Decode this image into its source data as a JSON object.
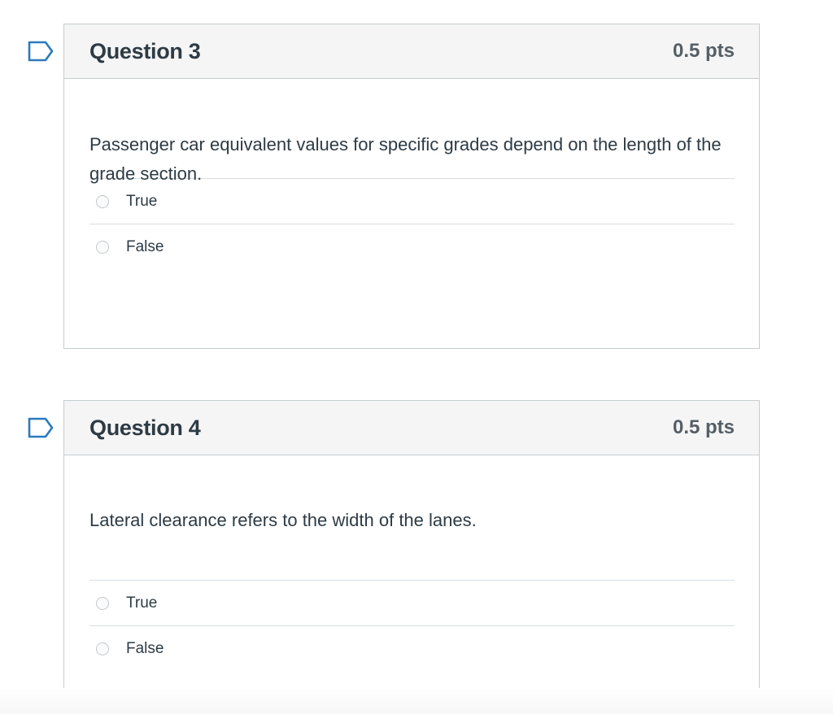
{
  "questions": [
    {
      "title": "Question 3",
      "points": "0.5 pts",
      "text": "Passenger car equivalent values for specific grades depend on the length of the grade section.",
      "answers": [
        "True",
        "False"
      ]
    },
    {
      "title": "Question 4",
      "points": "0.5 pts",
      "text": "Lateral clearance refers to the width of the lanes.",
      "answers": [
        "True",
        "False"
      ]
    }
  ],
  "icons": {
    "flag": "bookmark-flag-icon",
    "radio": "radio-unselected"
  },
  "colors": {
    "flag": "#2b7abc",
    "header_bg": "#f5f5f5",
    "border": "#c7cdd1",
    "text": "#2d3b45",
    "points": "#555f66"
  }
}
